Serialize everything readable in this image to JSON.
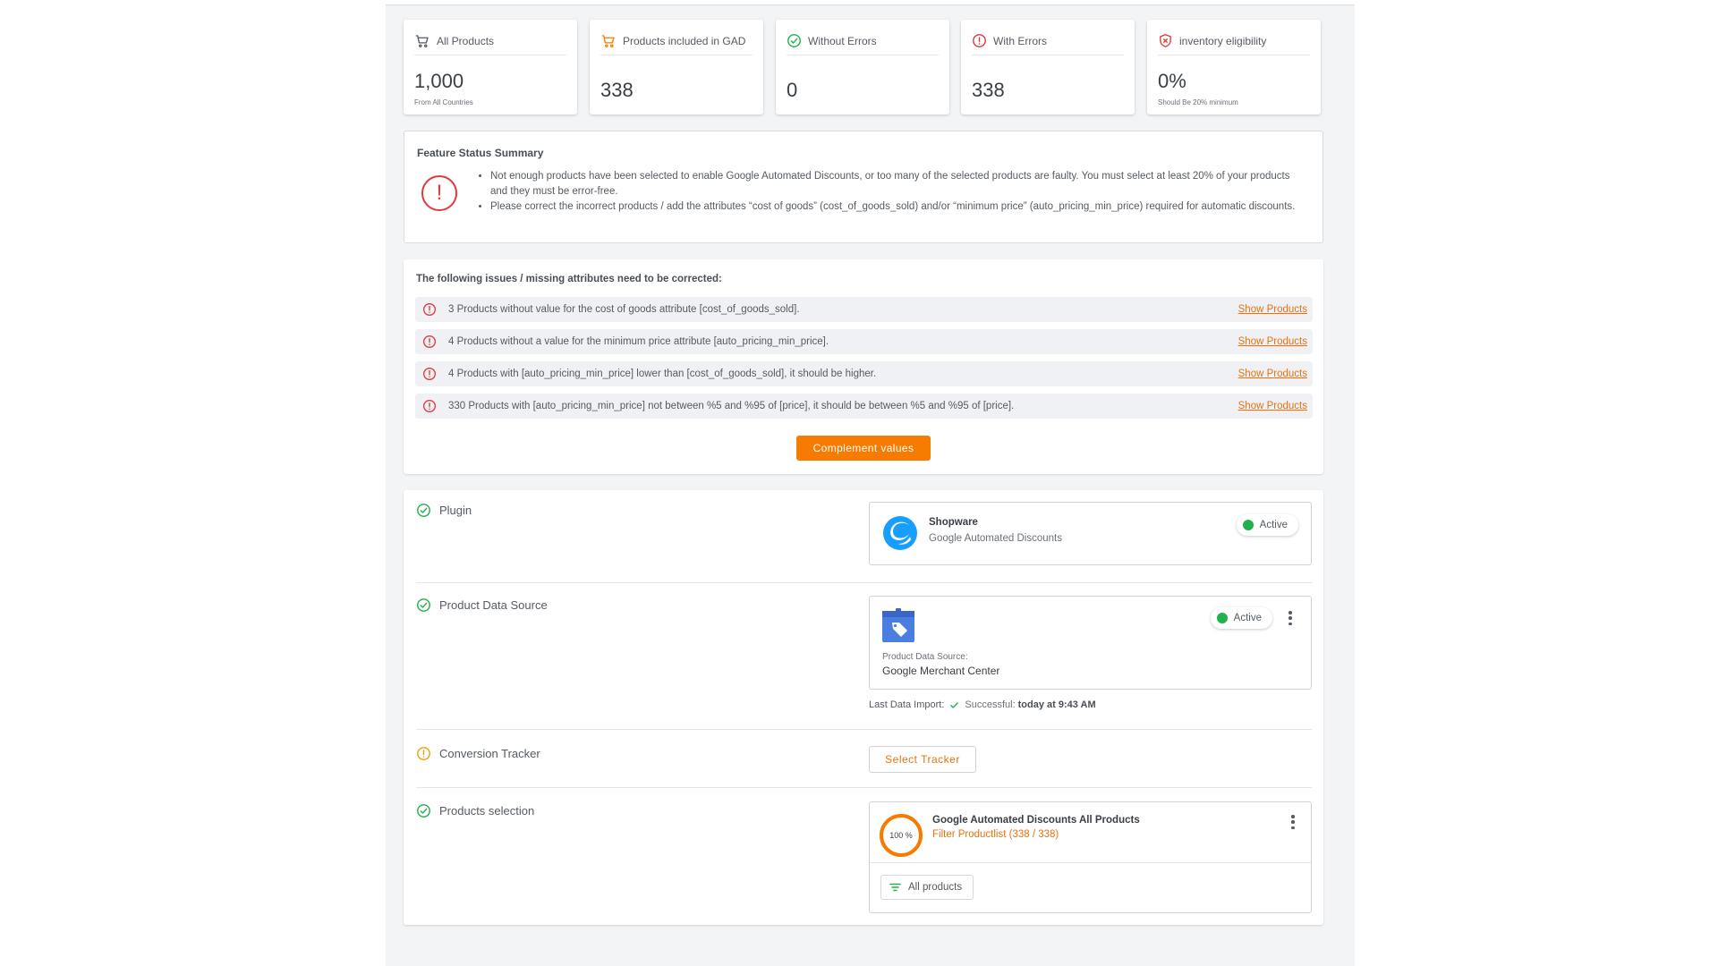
{
  "stats": [
    {
      "title": "All Products",
      "icon": "cart-icon",
      "value": "1,000",
      "sub": "From All Countries"
    },
    {
      "title": "Products included in GAD",
      "icon": "cart-orange-icon",
      "value": "338",
      "sub": ""
    },
    {
      "title": "Without Errors",
      "icon": "check-circle-icon",
      "value": "0",
      "sub": ""
    },
    {
      "title": "With Errors",
      "icon": "error-circle-icon",
      "value": "338",
      "sub": ""
    },
    {
      "title": "inventory eligibility",
      "icon": "shield-x-icon",
      "value": "0%",
      "sub": "Should Be 20% minimum"
    }
  ],
  "feature": {
    "title": "Feature Status Summary",
    "alert_glyph": "!",
    "items": [
      "Not enough products have been selected to enable Google Automated Discounts, or too many of the selected products are faulty. You must select at least 20% of your products and they must be error-free.",
      "Please correct the incorrect products / add the attributes “cost of goods” (cost_of_goods_sold) and/or “minimum price” (auto_pricing_min_price) required for automatic discounts."
    ]
  },
  "issues": {
    "title": "The following issues / missing attributes need to be corrected:",
    "link_label": "Show Products",
    "rows": [
      "3 Products without value for the cost of goods attribute [cost_of_goods_sold].",
      "4 Products without a value for the minimum price attribute [auto_pricing_min_price].",
      "4 Products with [auto_pricing_min_price] lower than [cost_of_goods_sold], it should be higher.",
      "330 Products with [auto_pricing_min_price] not between %5 and %95 of [price], it should be between %5 and %95 of [price]."
    ],
    "button_label": "Complement values"
  },
  "setup": {
    "plugin": {
      "label": "Plugin",
      "name": "Shopware",
      "desc": "Google Automated Discounts",
      "status": "Active"
    },
    "data_source": {
      "label": "Product Data Source",
      "caption": "Product Data Source:",
      "name": "Google Merchant Center",
      "status": "Active",
      "import_label": "Last Data Import:",
      "import_status": "Successful:",
      "import_time": "today at 9:43 AM"
    },
    "tracker": {
      "label": "Conversion Tracker",
      "button_label": "Select Tracker"
    },
    "selection": {
      "label": "Products selection",
      "percent_label": "100 %",
      "percent_value": 100,
      "title": "Google Automated Discounts All Products",
      "subtitle": "Filter Productlist (338 / 338)",
      "filter_label": "All products"
    }
  },
  "colors": {
    "accent": "#f57c00",
    "error": "#e03a3a",
    "success": "#22b14c",
    "warning": "#e8a20c"
  }
}
